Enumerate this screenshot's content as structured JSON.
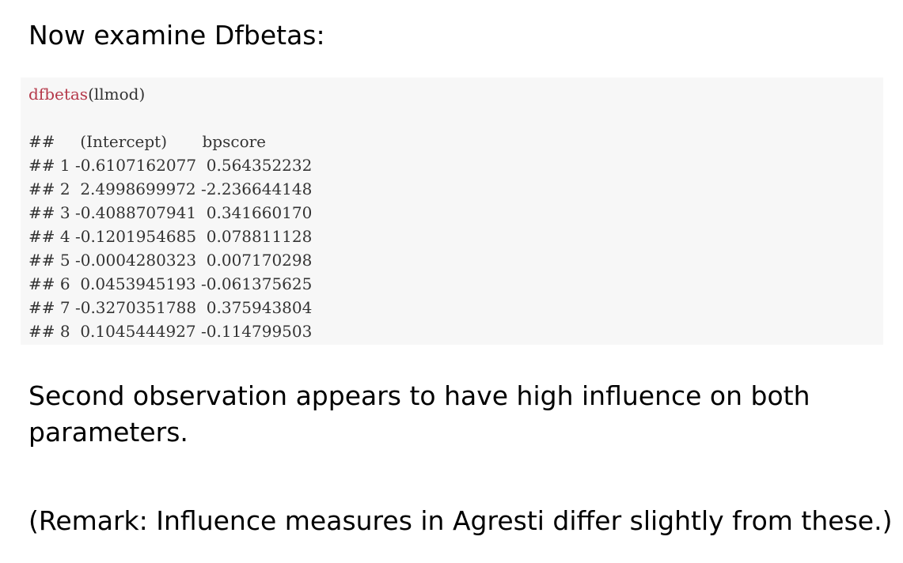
{
  "heading": "Now examine Dfbetas:",
  "code": {
    "function_name": "dfbetas",
    "call_args": "(llmod)",
    "output_lines": [
      "##     (Intercept)       bpscore",
      "## 1 -0.6107162077  0.564352232",
      "## 2  2.4998699972 -2.236644148",
      "## 3 -0.4088707941  0.341660170",
      "## 4 -0.1201954685  0.078811128",
      "## 5 -0.0004280323  0.007170298",
      "## 6  0.0453945193 -0.061375625",
      "## 7 -0.3270351788  0.375943804",
      "## 8  0.1045444927 -0.114799503"
    ]
  },
  "paragraphs": {
    "observation": "Second observation appears to have high influence on both parameters.",
    "remark": "(Remark: Influence measures in Agresti differ slightly from these.)"
  },
  "colors": {
    "function_name": "#b5394a",
    "code_background": "#f7f7f7",
    "code_text": "#333333"
  }
}
